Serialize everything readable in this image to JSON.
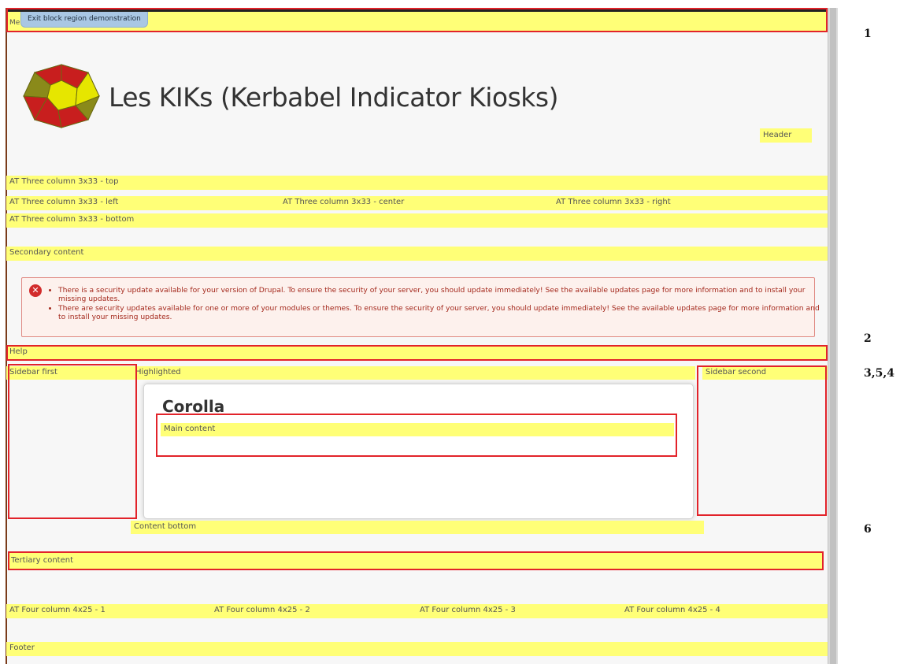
{
  "toolbar": {
    "menu_label": "Me",
    "exit_label": "Exit block region demonstration"
  },
  "site": {
    "title": "Les KIKs (Kerbabel Indicator Kiosks)",
    "logo_colors": {
      "face_yellow": "#e6e600",
      "face_red": "#c81e1e",
      "face_olive": "#8a8a1a"
    }
  },
  "regions": {
    "header": "Header",
    "three_top": "AT Three column 3x33 - top",
    "three_left": "AT Three column 3x33 - left",
    "three_center": "AT Three column 3x33 - center",
    "three_right": "AT Three column 3x33 - right",
    "three_bottom": "AT Three column 3x33 - bottom",
    "secondary": "Secondary content",
    "help": "Help",
    "sidebar_first": "Sidebar first",
    "highlighted": "Highlighted",
    "sidebar_second": "Sidebar second",
    "main_content": "Main content",
    "content_bottom": "Content bottom",
    "tertiary": "Tertiary content",
    "four_1": "AT Four column 4x25 - 1",
    "four_2": "AT Four column 4x25 - 2",
    "four_3": "AT Four column 4x25 - 3",
    "four_4": "AT Four column 4x25 - 4",
    "footer": "Footer"
  },
  "messages": {
    "items": [
      "There is a security update available for your version of Drupal. To ensure the security of your server, you should update immediately! See the available updates page for more information and to install your missing updates.",
      "There are security updates available for one or more of your modules or themes. To ensure the security of your server, you should update immediately! See the available updates page for more information and to install your missing updates."
    ]
  },
  "main": {
    "title": "Corolla"
  },
  "annotations": [
    "1",
    "2",
    "3,5,4",
    "6"
  ],
  "colors": {
    "region_yellow": "#ffff77",
    "highlight_red": "#e2232a",
    "error_red": "#a4291d"
  }
}
